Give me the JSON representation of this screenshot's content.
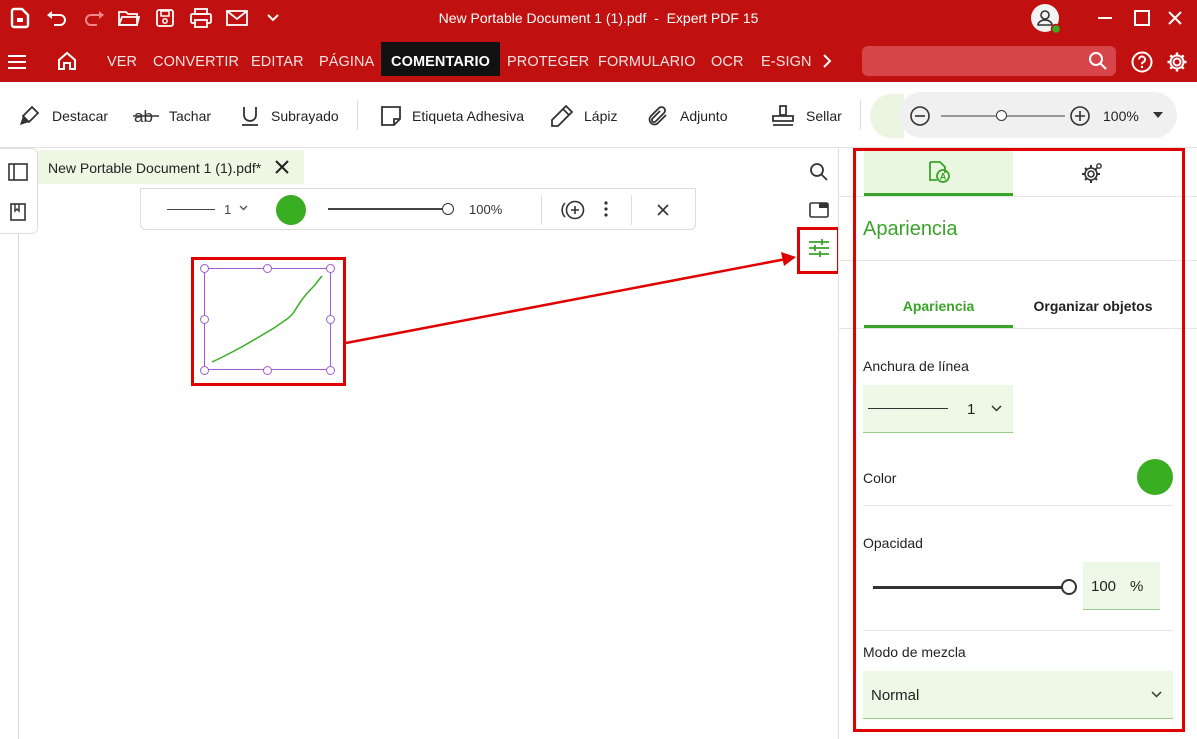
{
  "titlebar": {
    "title": "New Portable Document 1 (1).pdf  -  Expert PDF 15"
  },
  "menu": {
    "items": [
      "VER",
      "CONVERTIR",
      "EDITAR",
      "PÁGINA",
      "COMENTARIO",
      "PROTEGER",
      "FORMULARIO",
      "OCR",
      "E-SIGN"
    ],
    "active": "COMENTARIO"
  },
  "ribbon": {
    "highlight": "Destacar",
    "strikeout": "Tachar",
    "underline": "Subrayado",
    "sticky_note": "Etiqueta Adhesiva",
    "pencil": "Lápiz",
    "attachment": "Adjunto",
    "stamp": "Sellar",
    "zoom_value": "100%"
  },
  "document": {
    "tab_title": "New Portable Document 1 (1).pdf*"
  },
  "prop_toolbar": {
    "line_width": "1",
    "opacity": "100%",
    "opacity_fraction": 1.0
  },
  "panel": {
    "heading": "Apariencia",
    "subtab_appearance": "Apariencia",
    "subtab_arrange": "Organizar objetos",
    "line_width_label": "Anchura de línea",
    "line_width_value": "1",
    "color_label": "Color",
    "opacity_label": "Opacidad",
    "opacity_value": "100",
    "opacity_unit": "%",
    "opacity_fraction": 1.0,
    "blend_label": "Modo de mezcla",
    "blend_value": "Normal"
  },
  "colors": {
    "brand_red": "#c0100f",
    "accent_green": "#3aa32a",
    "annotation_color": "#3aae22",
    "callout_red": "#e00000"
  },
  "icons": [
    "app-logo-icon",
    "undo-icon",
    "redo-icon",
    "open-folder-icon",
    "save-icon",
    "print-icon",
    "mail-icon",
    "chevron-down-icon",
    "user-avatar-icon",
    "minimize-icon",
    "maximize-icon",
    "close-icon",
    "hamburger-menu-icon",
    "home-icon",
    "chevron-right-icon",
    "search-icon",
    "help-icon",
    "gear-icon",
    "highlighter-icon",
    "strikethrough-icon",
    "underline-icon",
    "sticky-note-icon",
    "pencil-icon",
    "paperclip-icon",
    "stamp-icon",
    "zoom-out-icon",
    "zoom-in-icon",
    "sidebar-toggle-icon",
    "bookmark-icon",
    "appearance-icon",
    "properties-sliders-icon",
    "cards-icon",
    "more-vertical-icon",
    "add-circle-icon"
  ]
}
